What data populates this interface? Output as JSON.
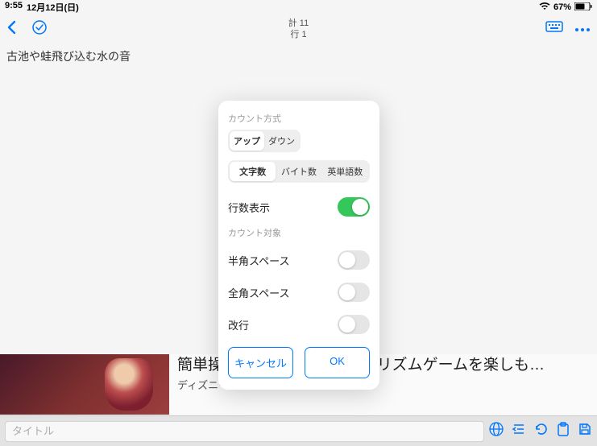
{
  "status": {
    "time": "9:55",
    "date": "12月12日(日)",
    "battery": "67%"
  },
  "nav": {
    "counter_total_label": "計 11",
    "counter_lines_label": "行 1"
  },
  "content": {
    "text": "古池や蛙飛び込む水の音"
  },
  "modal": {
    "count_method_title": "カウント方式",
    "direction": {
      "up": "アップ",
      "down": "ダウン"
    },
    "unit": {
      "chars": "文字数",
      "bytes": "バイト数",
      "words": "英単語数"
    },
    "show_lines_label": "行数表示",
    "count_target_title": "カウント対象",
    "half_space_label": "半角スペース",
    "full_space_label": "全角スペース",
    "newline_label": "改行",
    "cancel": "キャンセル",
    "ok": "OK"
  },
  "ad": {
    "title": "簡単操作のコマンドバトルとリズムゲームを楽しも…",
    "subtitle": "ディズニー ツイステッドワンダーランド"
  },
  "bottom": {
    "title_placeholder": "タイトル"
  }
}
